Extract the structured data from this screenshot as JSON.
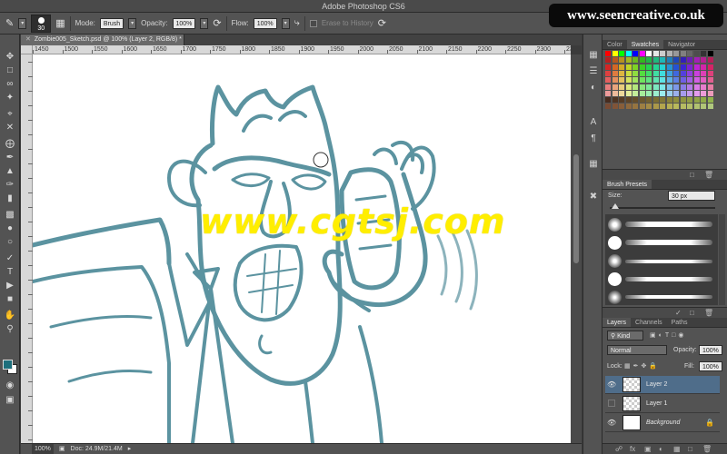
{
  "window": {
    "title": "Adobe Photoshop CS6"
  },
  "watermarks": {
    "site": "www.seencreative.co.uk",
    "center": "www.cgtsj.com"
  },
  "options_bar": {
    "brush_size": "30",
    "mode_label": "Mode:",
    "mode_value": "Brush",
    "opacity_label": "Opacity:",
    "opacity_value": "100%",
    "flow_label": "Flow:",
    "flow_value": "100%",
    "erase_history_label": "Erase to History"
  },
  "document": {
    "tab_title": "Zombie005_Sketch.psd @ 100% (Layer 2, RGB/8)",
    "tab_marker": "*",
    "ruler_labels": [
      "1450",
      "1500",
      "1550",
      "1600",
      "1650",
      "1700",
      "1750",
      "1800",
      "1850",
      "1900",
      "1950",
      "2000",
      "2050",
      "2100",
      "2150",
      "2200",
      "2250",
      "2300",
      "2350"
    ],
    "zoom": "100%",
    "doc_info": "Doc: 24.9M/21.4M",
    "sketch_color": "#5b93a0"
  },
  "tools": [
    "move",
    "marquee",
    "lasso",
    "quick-select",
    "crop",
    "eyedropper",
    "healing",
    "brush",
    "stamp",
    "history-brush",
    "eraser",
    "gradient",
    "blur",
    "dodge",
    "pen",
    "type",
    "path-select",
    "shape",
    "hand",
    "zoom"
  ],
  "swatches_panel": {
    "tabs": [
      "Color",
      "Swatches",
      "Navigator"
    ],
    "active_tab": "Swatches"
  },
  "brush_presets": {
    "tab": "Brush Presets",
    "size_label": "Size:",
    "size_value": "30 px"
  },
  "layers_panel": {
    "tabs": [
      "Layers",
      "Channels",
      "Paths"
    ],
    "active_tab": "Layers",
    "filter_label": "Kind",
    "blend_mode": "Normal",
    "opacity_label": "Opacity:",
    "opacity_value": "100%",
    "lock_label": "Lock:",
    "fill_label": "Fill:",
    "fill_value": "100%",
    "layers": [
      {
        "name": "Layer 2",
        "visible": true,
        "selected": true,
        "thumb": "checker"
      },
      {
        "name": "Layer 1",
        "visible": false,
        "selected": false,
        "thumb": "checker"
      },
      {
        "name": "Background",
        "visible": true,
        "selected": false,
        "thumb": "white",
        "locked": true
      }
    ]
  }
}
